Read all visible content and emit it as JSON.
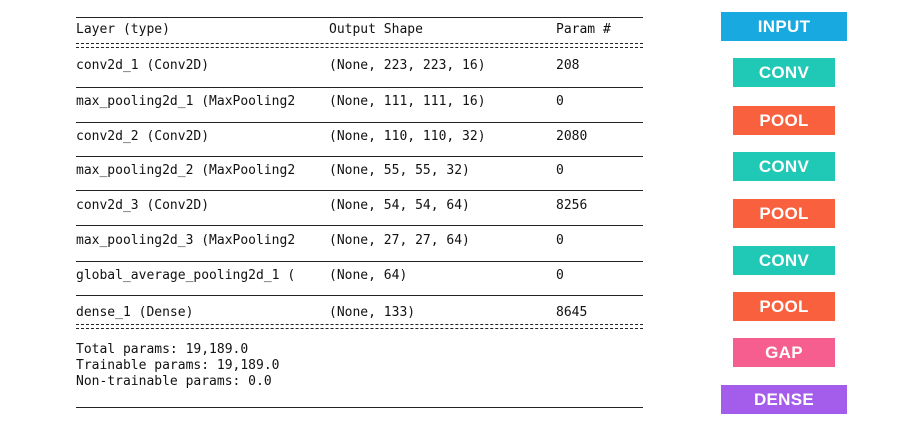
{
  "summary": {
    "headers": {
      "layer": "Layer (type)",
      "shape": "Output Shape",
      "params": "Param #"
    },
    "rows": [
      {
        "layer": "conv2d_1 (Conv2D)",
        "shape": "(None, 223, 223, 16)",
        "params": "208"
      },
      {
        "layer": "max_pooling2d_1 (MaxPooling2",
        "shape": "(None, 111, 111, 16)",
        "params": "0"
      },
      {
        "layer": "conv2d_2 (Conv2D)",
        "shape": "(None, 110, 110, 32)",
        "params": "2080"
      },
      {
        "layer": "max_pooling2d_2 (MaxPooling2",
        "shape": "(None, 55, 55, 32)",
        "params": "0"
      },
      {
        "layer": "conv2d_3 (Conv2D)",
        "shape": "(None, 54, 54, 64)",
        "params": "8256"
      },
      {
        "layer": "max_pooling2d_3 (MaxPooling2",
        "shape": "(None, 27, 27, 64)",
        "params": "0"
      },
      {
        "layer": "global_average_pooling2d_1 (",
        "shape": "(None, 64)",
        "params": "0"
      },
      {
        "layer": "dense_1 (Dense)",
        "shape": "(None, 133)",
        "params": "8645"
      }
    ],
    "totals": {
      "total": "Total params: 19,189.0",
      "trainable": "Trainable params: 19,189.0",
      "non_trainable": "Non-trainable params: 0.0"
    }
  },
  "blocks": [
    {
      "label": "INPUT",
      "color": "#18A9E0"
    },
    {
      "label": "CONV",
      "color": "#20C9B6"
    },
    {
      "label": "POOL",
      "color": "#F9603E"
    },
    {
      "label": "CONV",
      "color": "#20C9B6"
    },
    {
      "label": "POOL",
      "color": "#F9603E"
    },
    {
      "label": "CONV",
      "color": "#20C9B6"
    },
    {
      "label": "POOL",
      "color": "#F9603E"
    },
    {
      "label": "GAP",
      "color": "#F55E8E"
    },
    {
      "label": "DENSE",
      "color": "#A45DEB"
    }
  ]
}
